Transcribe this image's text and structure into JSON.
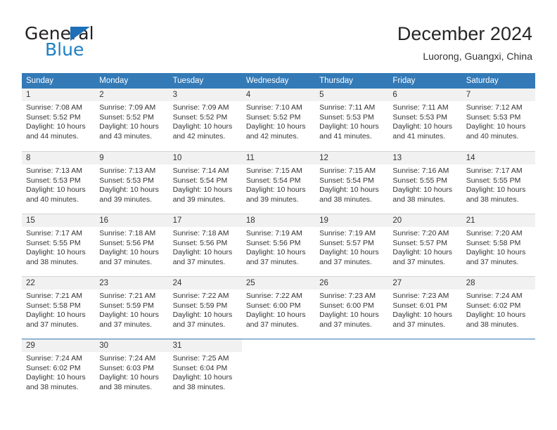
{
  "brand": {
    "name_part1": "General",
    "name_part2": "Blue",
    "triangle_color": "#1d6fb8",
    "blue_color": "#1d7fc4"
  },
  "header": {
    "title": "December 2024",
    "subtitle": "Luorong, Guangxi, China"
  },
  "theme": {
    "header_blue": "#337ab7",
    "day_band_gray": "#f1f1f1",
    "grid_line": "#d4d4d4"
  },
  "weekdays": [
    "Sunday",
    "Monday",
    "Tuesday",
    "Wednesday",
    "Thursday",
    "Friday",
    "Saturday"
  ],
  "weeks": [
    [
      {
        "day": "1",
        "sunrise": "Sunrise: 7:08 AM",
        "sunset": "Sunset: 5:52 PM",
        "daylight1": "Daylight: 10 hours",
        "daylight2": "and 44 minutes."
      },
      {
        "day": "2",
        "sunrise": "Sunrise: 7:09 AM",
        "sunset": "Sunset: 5:52 PM",
        "daylight1": "Daylight: 10 hours",
        "daylight2": "and 43 minutes."
      },
      {
        "day": "3",
        "sunrise": "Sunrise: 7:09 AM",
        "sunset": "Sunset: 5:52 PM",
        "daylight1": "Daylight: 10 hours",
        "daylight2": "and 42 minutes."
      },
      {
        "day": "4",
        "sunrise": "Sunrise: 7:10 AM",
        "sunset": "Sunset: 5:52 PM",
        "daylight1": "Daylight: 10 hours",
        "daylight2": "and 42 minutes."
      },
      {
        "day": "5",
        "sunrise": "Sunrise: 7:11 AM",
        "sunset": "Sunset: 5:53 PM",
        "daylight1": "Daylight: 10 hours",
        "daylight2": "and 41 minutes."
      },
      {
        "day": "6",
        "sunrise": "Sunrise: 7:11 AM",
        "sunset": "Sunset: 5:53 PM",
        "daylight1": "Daylight: 10 hours",
        "daylight2": "and 41 minutes."
      },
      {
        "day": "7",
        "sunrise": "Sunrise: 7:12 AM",
        "sunset": "Sunset: 5:53 PM",
        "daylight1": "Daylight: 10 hours",
        "daylight2": "and 40 minutes."
      }
    ],
    [
      {
        "day": "8",
        "sunrise": "Sunrise: 7:13 AM",
        "sunset": "Sunset: 5:53 PM",
        "daylight1": "Daylight: 10 hours",
        "daylight2": "and 40 minutes."
      },
      {
        "day": "9",
        "sunrise": "Sunrise: 7:13 AM",
        "sunset": "Sunset: 5:53 PM",
        "daylight1": "Daylight: 10 hours",
        "daylight2": "and 39 minutes."
      },
      {
        "day": "10",
        "sunrise": "Sunrise: 7:14 AM",
        "sunset": "Sunset: 5:54 PM",
        "daylight1": "Daylight: 10 hours",
        "daylight2": "and 39 minutes."
      },
      {
        "day": "11",
        "sunrise": "Sunrise: 7:15 AM",
        "sunset": "Sunset: 5:54 PM",
        "daylight1": "Daylight: 10 hours",
        "daylight2": "and 39 minutes."
      },
      {
        "day": "12",
        "sunrise": "Sunrise: 7:15 AM",
        "sunset": "Sunset: 5:54 PM",
        "daylight1": "Daylight: 10 hours",
        "daylight2": "and 38 minutes."
      },
      {
        "day": "13",
        "sunrise": "Sunrise: 7:16 AM",
        "sunset": "Sunset: 5:55 PM",
        "daylight1": "Daylight: 10 hours",
        "daylight2": "and 38 minutes."
      },
      {
        "day": "14",
        "sunrise": "Sunrise: 7:17 AM",
        "sunset": "Sunset: 5:55 PM",
        "daylight1": "Daylight: 10 hours",
        "daylight2": "and 38 minutes."
      }
    ],
    [
      {
        "day": "15",
        "sunrise": "Sunrise: 7:17 AM",
        "sunset": "Sunset: 5:55 PM",
        "daylight1": "Daylight: 10 hours",
        "daylight2": "and 38 minutes."
      },
      {
        "day": "16",
        "sunrise": "Sunrise: 7:18 AM",
        "sunset": "Sunset: 5:56 PM",
        "daylight1": "Daylight: 10 hours",
        "daylight2": "and 37 minutes."
      },
      {
        "day": "17",
        "sunrise": "Sunrise: 7:18 AM",
        "sunset": "Sunset: 5:56 PM",
        "daylight1": "Daylight: 10 hours",
        "daylight2": "and 37 minutes."
      },
      {
        "day": "18",
        "sunrise": "Sunrise: 7:19 AM",
        "sunset": "Sunset: 5:56 PM",
        "daylight1": "Daylight: 10 hours",
        "daylight2": "and 37 minutes."
      },
      {
        "day": "19",
        "sunrise": "Sunrise: 7:19 AM",
        "sunset": "Sunset: 5:57 PM",
        "daylight1": "Daylight: 10 hours",
        "daylight2": "and 37 minutes."
      },
      {
        "day": "20",
        "sunrise": "Sunrise: 7:20 AM",
        "sunset": "Sunset: 5:57 PM",
        "daylight1": "Daylight: 10 hours",
        "daylight2": "and 37 minutes."
      },
      {
        "day": "21",
        "sunrise": "Sunrise: 7:20 AM",
        "sunset": "Sunset: 5:58 PM",
        "daylight1": "Daylight: 10 hours",
        "daylight2": "and 37 minutes."
      }
    ],
    [
      {
        "day": "22",
        "sunrise": "Sunrise: 7:21 AM",
        "sunset": "Sunset: 5:58 PM",
        "daylight1": "Daylight: 10 hours",
        "daylight2": "and 37 minutes."
      },
      {
        "day": "23",
        "sunrise": "Sunrise: 7:21 AM",
        "sunset": "Sunset: 5:59 PM",
        "daylight1": "Daylight: 10 hours",
        "daylight2": "and 37 minutes."
      },
      {
        "day": "24",
        "sunrise": "Sunrise: 7:22 AM",
        "sunset": "Sunset: 5:59 PM",
        "daylight1": "Daylight: 10 hours",
        "daylight2": "and 37 minutes."
      },
      {
        "day": "25",
        "sunrise": "Sunrise: 7:22 AM",
        "sunset": "Sunset: 6:00 PM",
        "daylight1": "Daylight: 10 hours",
        "daylight2": "and 37 minutes."
      },
      {
        "day": "26",
        "sunrise": "Sunrise: 7:23 AM",
        "sunset": "Sunset: 6:00 PM",
        "daylight1": "Daylight: 10 hours",
        "daylight2": "and 37 minutes."
      },
      {
        "day": "27",
        "sunrise": "Sunrise: 7:23 AM",
        "sunset": "Sunset: 6:01 PM",
        "daylight1": "Daylight: 10 hours",
        "daylight2": "and 37 minutes."
      },
      {
        "day": "28",
        "sunrise": "Sunrise: 7:24 AM",
        "sunset": "Sunset: 6:02 PM",
        "daylight1": "Daylight: 10 hours",
        "daylight2": "and 38 minutes."
      }
    ],
    [
      {
        "day": "29",
        "sunrise": "Sunrise: 7:24 AM",
        "sunset": "Sunset: 6:02 PM",
        "daylight1": "Daylight: 10 hours",
        "daylight2": "and 38 minutes."
      },
      {
        "day": "30",
        "sunrise": "Sunrise: 7:24 AM",
        "sunset": "Sunset: 6:03 PM",
        "daylight1": "Daylight: 10 hours",
        "daylight2": "and 38 minutes."
      },
      {
        "day": "31",
        "sunrise": "Sunrise: 7:25 AM",
        "sunset": "Sunset: 6:04 PM",
        "daylight1": "Daylight: 10 hours",
        "daylight2": "and 38 minutes."
      },
      {
        "day": "",
        "sunrise": "",
        "sunset": "",
        "daylight1": "",
        "daylight2": ""
      },
      {
        "day": "",
        "sunrise": "",
        "sunset": "",
        "daylight1": "",
        "daylight2": ""
      },
      {
        "day": "",
        "sunrise": "",
        "sunset": "",
        "daylight1": "",
        "daylight2": ""
      },
      {
        "day": "",
        "sunrise": "",
        "sunset": "",
        "daylight1": "",
        "daylight2": ""
      }
    ]
  ]
}
